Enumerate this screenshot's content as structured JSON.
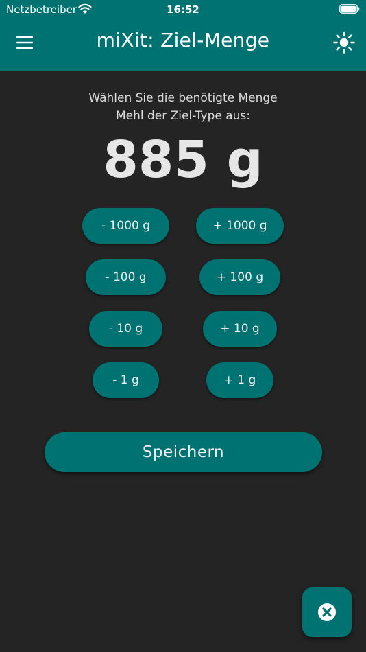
{
  "status_bar": {
    "carrier": "Netzbetreiber",
    "time": "16:52",
    "wifi_icon": "wifi-icon",
    "battery_icon": "battery-icon"
  },
  "header": {
    "title": "miXit: Ziel-Menge",
    "menu_icon": "hamburger-menu-icon",
    "theme_icon": "sun-icon",
    "background_color": "#007272"
  },
  "prompt": {
    "line1": "Wählen Sie die benötigte Menge",
    "line2": "Mehl der Ziel-Type aus:"
  },
  "amount": {
    "display": "885 g"
  },
  "step_buttons": {
    "minus_1000": "- 1000 g",
    "plus_1000": "+ 1000 g",
    "minus_100": "- 100 g",
    "plus_100": "+ 100 g",
    "minus_10": "- 10 g",
    "plus_10": "+ 10 g",
    "minus_1": "- 1 g",
    "plus_1": "+ 1 g"
  },
  "save_button": {
    "label": "Speichern"
  },
  "close_button": {
    "icon": "close-circle-icon"
  },
  "colors": {
    "accent": "#007272",
    "background": "#242424",
    "text": "#e6e6e6"
  }
}
